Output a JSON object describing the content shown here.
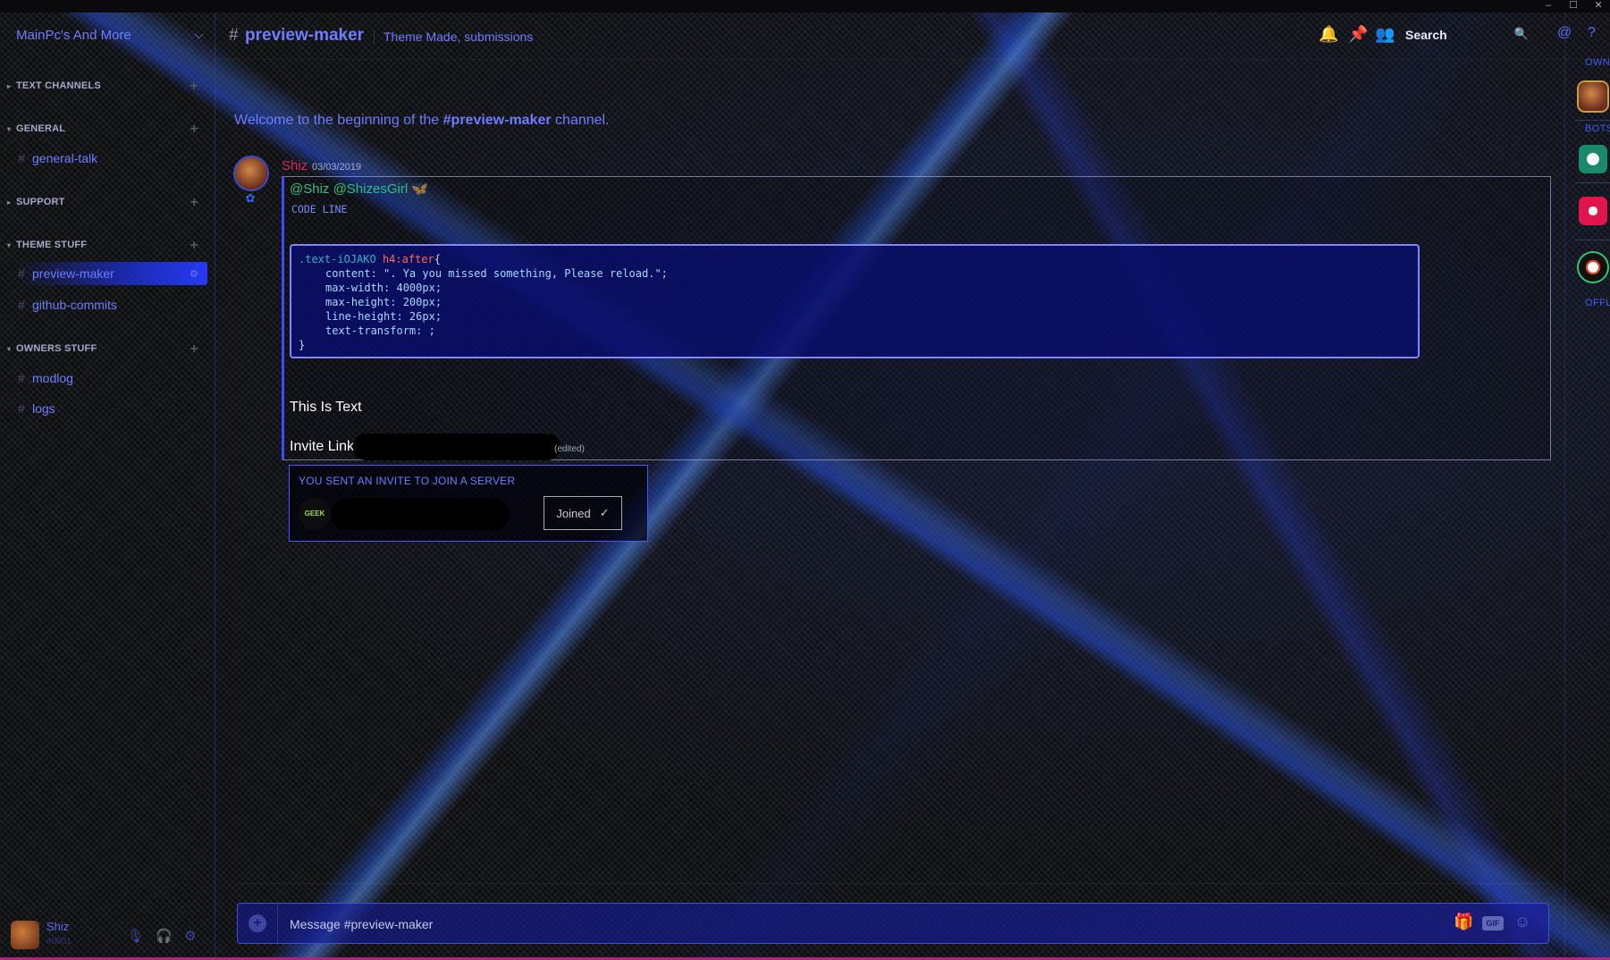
{
  "window": {
    "minimize": "–",
    "maximize": "☐",
    "close": "✕"
  },
  "server": {
    "name": "MainPc's And More"
  },
  "categories": [
    {
      "name": "TEXT CHANNELS",
      "channels": []
    },
    {
      "name": "GENERAL",
      "channels": [
        "general-talk"
      ]
    },
    {
      "name": "SUPPORT",
      "channels": []
    },
    {
      "name": "THEME STUFF",
      "channels": [
        "preview-maker",
        "github-commits"
      ]
    },
    {
      "name": "OWNERS STUFF",
      "channels": [
        "modlog",
        "logs"
      ]
    }
  ],
  "user": {
    "name": "Shiz",
    "tag": "#0001"
  },
  "header": {
    "hash": "#",
    "channel": "preview-maker",
    "topic": "Theme Made, submissions",
    "search_placeholder": "Search"
  },
  "welcome": {
    "prefix": "Welcome to the beginning of the ",
    "channel": "#preview-maker",
    "suffix": " channel."
  },
  "message": {
    "author": "Shiz",
    "timestamp": "03/03/2019",
    "mentions": "@Shiz @ShizesGirl",
    "code_line": "CODE LINE",
    "code": {
      "selector": ".text-iOJAKO",
      "tag": "h4",
      "pseudo": ":after",
      "open": "{",
      "lines": [
        "content: \". Ya you missed something, Please reload.\";",
        "max-width: 4000px;",
        "max-height: 200px;",
        "line-height: 26px;",
        "text-transform: ;"
      ],
      "close": "}"
    },
    "text": "This Is Text",
    "invite_label": "Invite Link: ",
    "edited": "(edited)"
  },
  "invite": {
    "title": "YOU SENT AN INVITE TO JOIN A SERVER",
    "server_icon": "GEEK",
    "button": "Joined",
    "button_icon": "✓"
  },
  "composer": {
    "placeholder": "Message #preview-maker",
    "gif": "GIF"
  },
  "members": {
    "groups": [
      "OWNER",
      "BOTS",
      "OFFLINE"
    ]
  },
  "colors": {
    "accent": "#6f7cff",
    "author": "#d22a6a",
    "mention": "#2fbf84",
    "code_bg": "#0a0e6e"
  }
}
